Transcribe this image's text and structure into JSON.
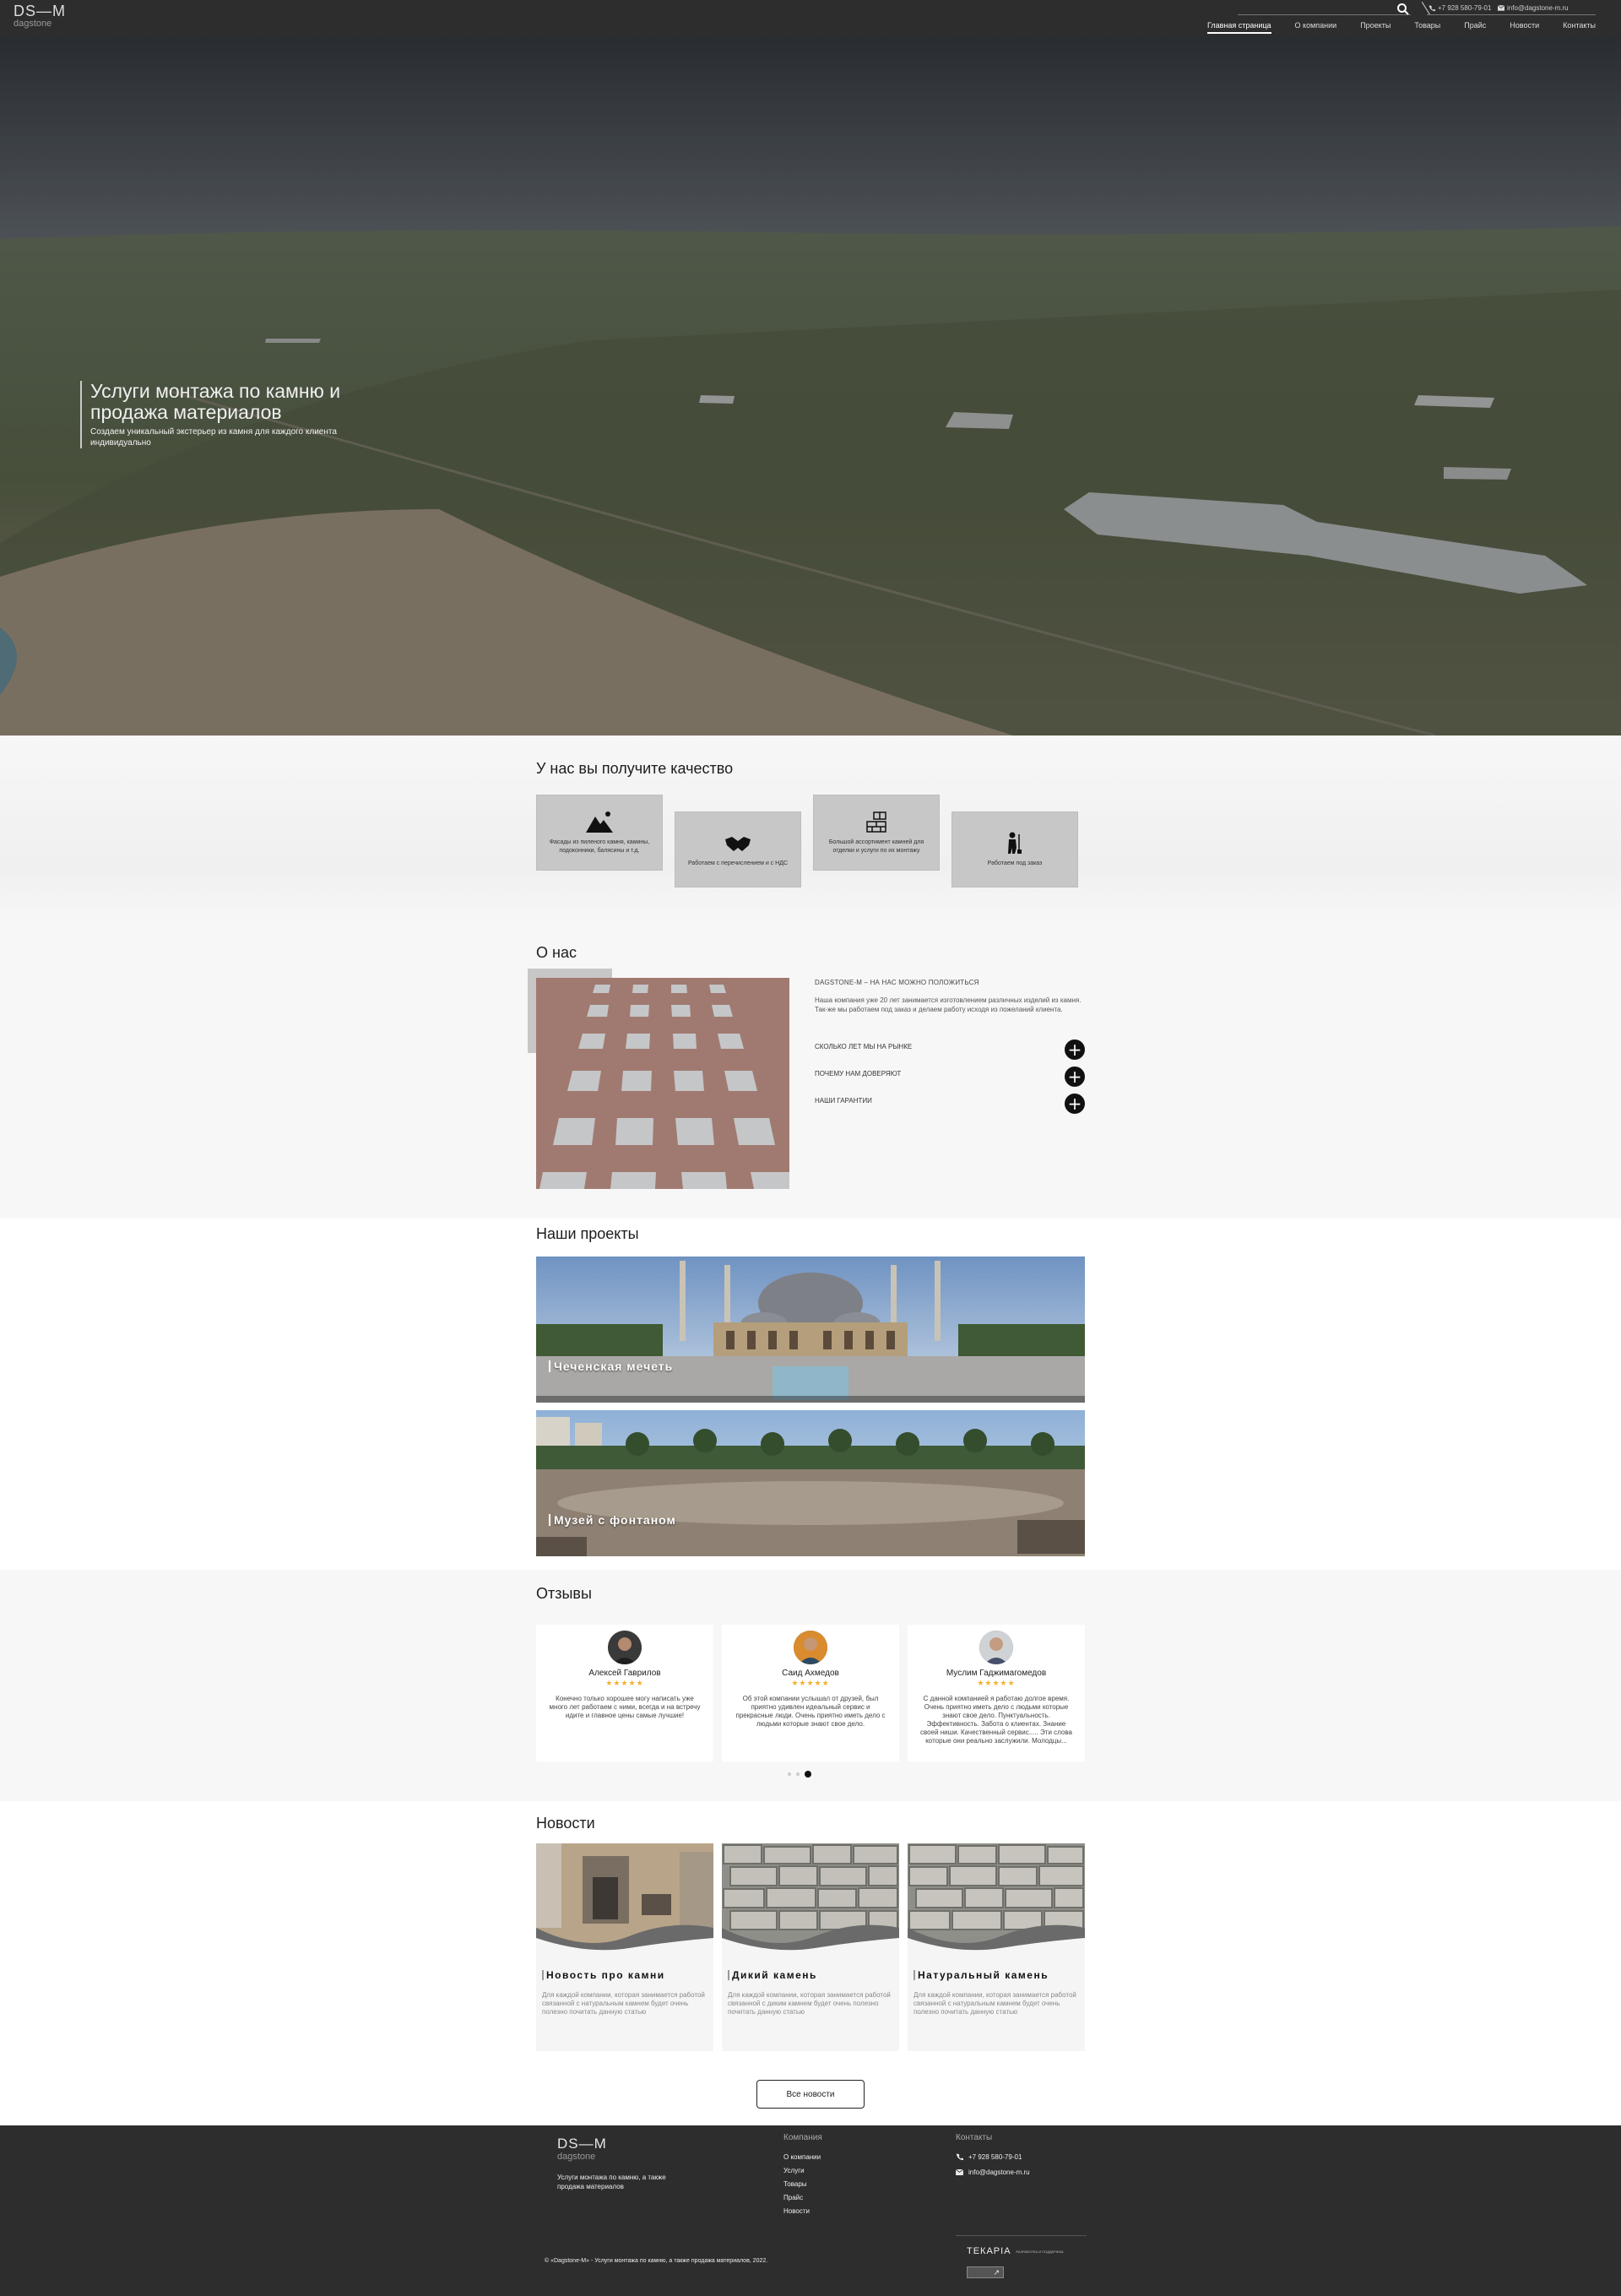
{
  "header": {
    "logo_main": "DS—M",
    "logo_sub": "dagstone",
    "phone": "+7 928 580-79-01",
    "email": "info@dagstone-m.ru",
    "nav": [
      "Главная страница",
      "О компании",
      "Проекты",
      "Товары",
      "Прайс",
      "Новости",
      "Контакты"
    ]
  },
  "hero": {
    "title": "Услуги монтажа по камню и продажа материалов",
    "subtitle": "Создаем уникальный экстерьер из камня для каждого клиента индивидуально"
  },
  "quality": {
    "title": "У нас вы получите качество",
    "cards": [
      {
        "icon": "mountain-icon",
        "text": "Фасады из пиленого камня, камины, подоконники, балясины и т.д."
      },
      {
        "icon": "handshake-icon",
        "text": "Работаем с перечислением и с НДС"
      },
      {
        "icon": "brick-wall-icon",
        "text": "Большой ассортимент камней для отделки и услуги по их монтажу"
      },
      {
        "icon": "worker-icon",
        "text": "Работаем под заказ"
      }
    ]
  },
  "about": {
    "title": "О нас",
    "heading": "DAGSTONE-M – НА НАС МОЖНО ПОЛОЖИТЬСЯ",
    "text": "Наша компания уже 20 лет занимается изготовлением различных изделий из камня. Так-же мы работаем под заказ и делаем работу исходя из пожеланий клиента.",
    "accordion": [
      "СКОЛЬКО ЛЕТ МЫ НА РЫНКЕ",
      "ПОЧЕМУ НАМ ДОВЕРЯЮТ",
      "НАШИ ГАРАНТИИ"
    ]
  },
  "projects": {
    "title": "Наши проекты",
    "items": [
      "Чеченская мечеть",
      "Музей с фонтаном"
    ]
  },
  "reviews": {
    "title": "Отзывы",
    "items": [
      {
        "name": "Алексей Гаврилов",
        "stars": "★★★★★",
        "text": "Конечно только хорошее могу написать уже много лет работаем с ними, всегда и на встречу идите и главное цены самые лучшие!"
      },
      {
        "name": "Саид Ахмедов",
        "stars": "★★★★★",
        "text": "Об этой компании услышал от друзей, был приятно удивлен идеальный сервис и прекрасные люди. Очень приятно иметь дело с людьми которые знают свое дело."
      },
      {
        "name": "Муслим Гаджимагомедов",
        "stars": "★★★★★",
        "text": "С данной компанией я работаю долгое время. Очень приятно иметь дело с людьми которые знают свое дело. Пунктуальность. Эффективность. Забота о клиентах. Знание своей ниши. Качественный сервис..... Эти слова которые они реально заслужили. Молодцы..."
      }
    ]
  },
  "news": {
    "title": "Новости",
    "items": [
      {
        "title": "Новость про камни",
        "text": "Для каждой компании, которая занимается работой связанной с натуральным камнем будет очень полезно почитать данную статью"
      },
      {
        "title": "Дикий камень",
        "text": "Для каждой компании, которая занимается работой связанной с диким камнем будет очень полезно почитать данную статью"
      },
      {
        "title": "Натуральный камень",
        "text": "Для каждой компании, которая занимается работой связанной с натуральным камнем будет очень полезно почитать данную статью"
      }
    ],
    "all_button": "Все новости"
  },
  "footer": {
    "logo_main": "DS—M",
    "logo_sub": "dagstone",
    "tagline": "Услуги монтажа по камню, а также продажа материалов",
    "company_title": "Компания",
    "company_links": [
      "О компании",
      "Услуги",
      "Товары",
      "Прайс",
      "Новости"
    ],
    "contacts_title": "Контакты",
    "phone": "+7 928 580-79-01",
    "email": "info@dagstone-m.ru",
    "copyright": "© «Dagstone-M» - Услуги монтажа по камню, а также продажа материалов, 2022.",
    "dev_name": "ТЕКАРIA",
    "dev_sub": "РАЗРАБОТКА И ПОДДЕРЖКА",
    "dev_badge": "↗"
  }
}
